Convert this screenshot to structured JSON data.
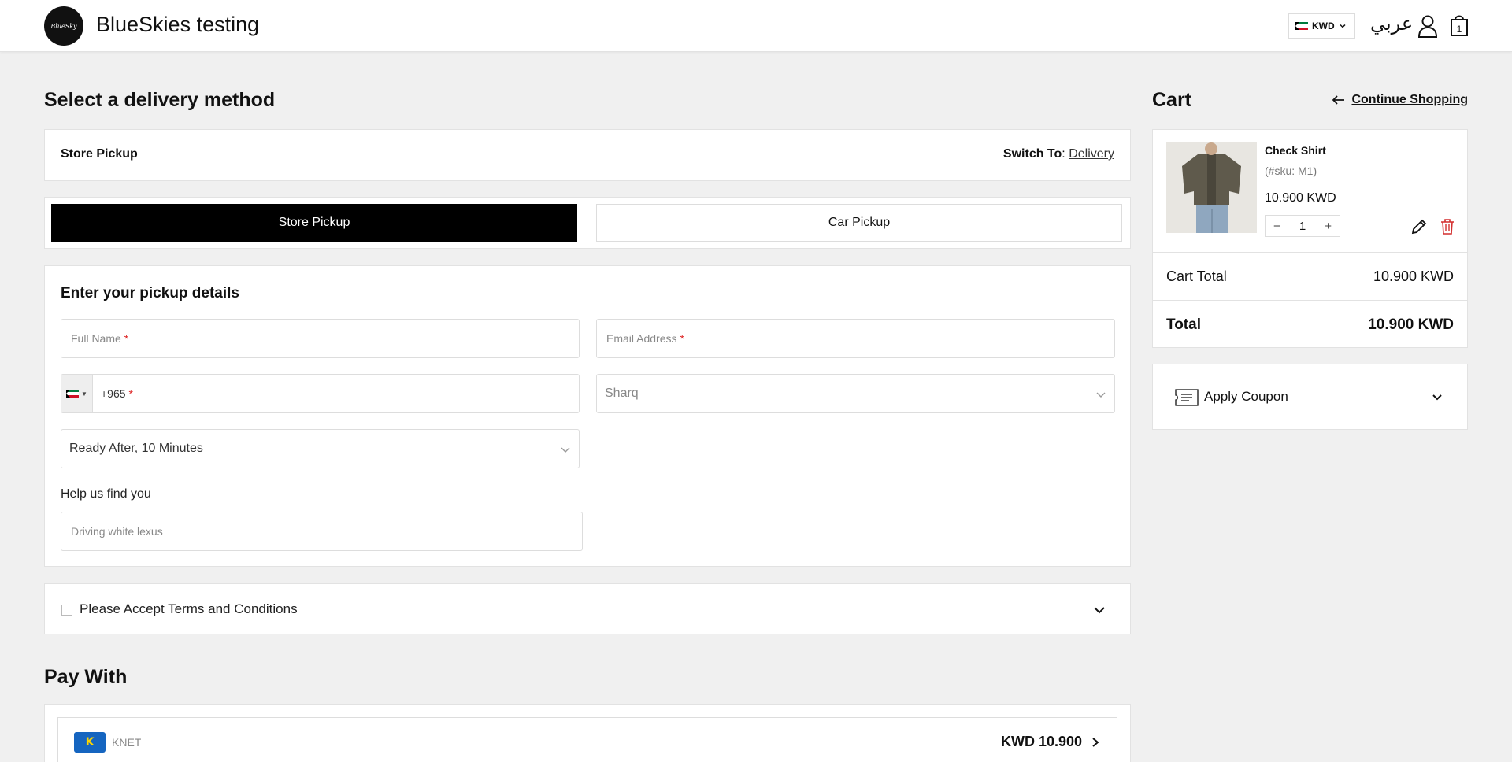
{
  "header": {
    "logo_text": "BlueSky",
    "store_name": "BlueSkies testing",
    "currency": "KWD",
    "language": "عربي",
    "cart_count": "1"
  },
  "delivery": {
    "heading": "Select a delivery method",
    "method_title": "Store Pickup",
    "switch_label": "Switch To",
    "switch_colon": ":",
    "switch_link": "Delivery",
    "tabs": [
      {
        "label": "Store Pickup",
        "active": true
      },
      {
        "label": "Car Pickup",
        "active": false
      }
    ]
  },
  "pickup": {
    "title": "Enter your pickup details",
    "full_name_placeholder": "Full Name",
    "email_placeholder": "Email Address",
    "phone_code": "+965",
    "required_mark": "*",
    "area_value": "Sharq",
    "ready_value": "Ready After, 10 Minutes",
    "help_label": "Help us find you",
    "help_placeholder": "Driving white lexus"
  },
  "terms": {
    "label": "Please Accept Terms and Conditions",
    "checked": false
  },
  "payment": {
    "heading": "Pay With",
    "method_name": "KNET",
    "amount": "KWD 10.900"
  },
  "cart": {
    "heading": "Cart",
    "continue_label": "Continue Shopping",
    "item": {
      "name": "Check Shirt",
      "sku": "(#sku: M1)",
      "price": "10.900 KWD",
      "quantity": "1"
    },
    "cart_total_label": "Cart Total",
    "cart_total_value": "10.900 KWD",
    "total_label": "Total",
    "total_value": "10.900 KWD",
    "coupon_label": "Apply Coupon"
  },
  "colors": {
    "accent": "#000000",
    "required": "#dd2222",
    "delete": "#d32f2f",
    "background": "#f0f0f0"
  }
}
